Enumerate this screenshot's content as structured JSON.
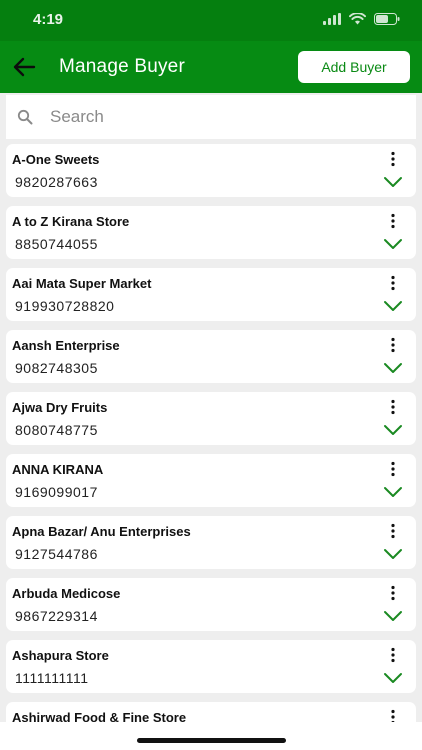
{
  "status": {
    "time": "4:19"
  },
  "header": {
    "title": "Manage Buyer",
    "add_label": "Add Buyer"
  },
  "search": {
    "placeholder": "Search"
  },
  "buyers": [
    {
      "name": "A-One Sweets",
      "phone": "9820287663"
    },
    {
      "name": "A to Z Kirana Store",
      "phone": "8850744055"
    },
    {
      "name": "Aai Mata Super Market",
      "phone": "919930728820"
    },
    {
      "name": "Aansh Enterprise",
      "phone": "9082748305"
    },
    {
      "name": "Ajwa Dry Fruits",
      "phone": "8080748775"
    },
    {
      "name": "ANNA KIRANA",
      "phone": "9169099017"
    },
    {
      "name": "Apna Bazar/ Anu Enterprises",
      "phone": "9127544786"
    },
    {
      "name": "Arbuda Medicose",
      "phone": "9867229314"
    },
    {
      "name": "Ashapura Store",
      "phone": "1111111111"
    },
    {
      "name": "Ashirwad Food & Fine Store",
      "phone": ""
    }
  ],
  "colors": {
    "primary": "#068b13",
    "chevron": "#1a8a22"
  }
}
